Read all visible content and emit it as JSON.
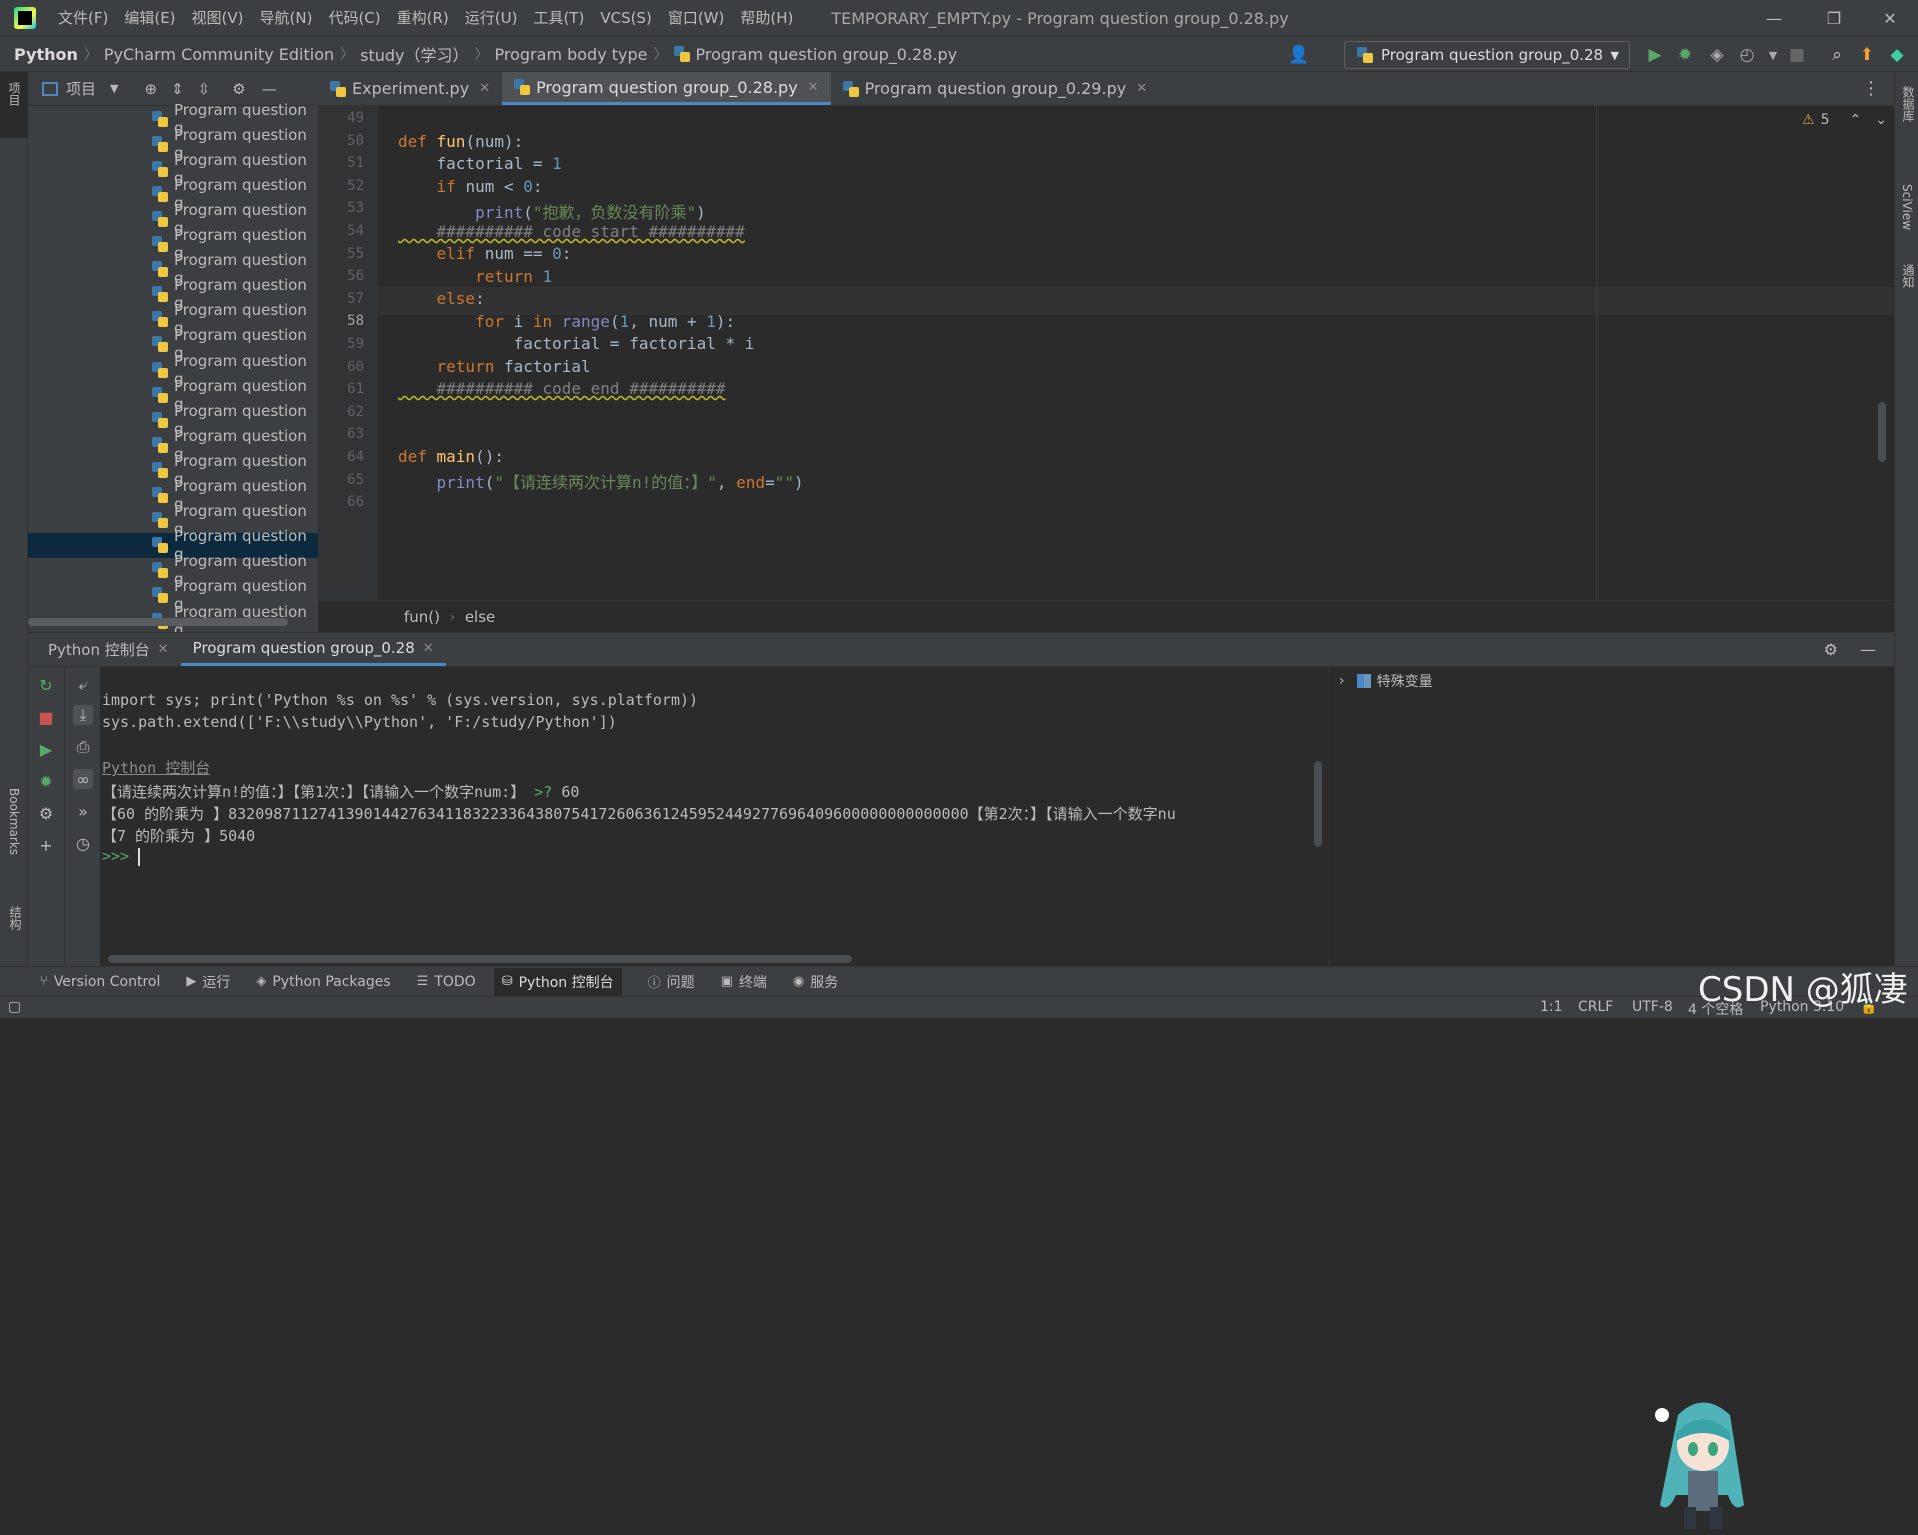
{
  "menu": [
    "文件(F)",
    "编辑(E)",
    "视图(V)",
    "导航(N)",
    "代码(C)",
    "重构(R)",
    "运行(U)",
    "工具(T)",
    "VCS(S)",
    "窗口(W)",
    "帮助(H)"
  ],
  "window_title": "TEMPORARY_EMPTY.py - Program question group_0.28.py",
  "breadcrumbs": [
    "Python",
    "PyCharm Community Edition",
    "study（学习）",
    "Program body type",
    "Program question group_0.28.py"
  ],
  "run_config": "Program question group_0.28",
  "project_panel": {
    "title": "项目",
    "item_label": "Program question g",
    "selected_index": 17,
    "count": 21
  },
  "editor_tabs": [
    {
      "label": "Experiment.py"
    },
    {
      "label": "Program question group_0.28.py"
    },
    {
      "label": "Program question group_0.29.py"
    }
  ],
  "warnings": "5",
  "line_numbers": [
    "49",
    "50",
    "51",
    "52",
    "53",
    "54",
    "55",
    "56",
    "57",
    "58",
    "59",
    "60",
    "61",
    "62",
    "63",
    "64",
    "65",
    "66"
  ],
  "code": {
    "l51_def": "def ",
    "l51_fn": "fun",
    "l51_rest": "(num):",
    "l52_a": "    factorial = ",
    "l52_n": "1",
    "l53_kw": "    if ",
    "l53_rest": "num < ",
    "l53_n": "0",
    "l53_c": ":",
    "l54_bi": "        print",
    "l54_p": "(",
    "l54_s": "\"抱歉，负数没有阶乘\"",
    "l54_e": ")",
    "l55_cm": "    ########## code start ##########",
    "l56_kw": "    elif ",
    "l56_rest": "num == ",
    "l56_n": "0",
    "l56_c": ":",
    "l57_kw": "        return ",
    "l57_n": "1",
    "l58_kw": "    else",
    ":": ":",
    "l59_kw": "        for ",
    "l59_a": "i ",
    "l59_in": "in ",
    "l59_bi": "range",
    "l59_p": "(",
    "l59_n1": "1",
    "l59_b": ", num + ",
    "l59_n2": "1",
    "l59_e": "):",
    "l60": "            factorial = factorial * i",
    "l61_kw": "    return ",
    "l61_rest": "factorial",
    "l62_cm": "    ########## code end ##########",
    "l65_def": "def ",
    "l65_fn": "main",
    "l65_rest": "():",
    "l66_bi": "    print",
    "l66_p": "(",
    "l66_s": "\"【请连续两次计算n!的值：】\"",
    "l66_c": ", ",
    "l66_kw": "end",
    "l66_eq": "=",
    "l66_s2": "\"\"",
    "l66_e": ")"
  },
  "editor_breadcrumb": [
    "fun()",
    "else"
  ],
  "bottom_tabs": [
    "Python 控制台",
    "Program question group_0.28"
  ],
  "console": {
    "line1": "import sys; print('Python %s on %s' % (sys.version, sys.platform))",
    "line2": "sys.path.extend(['F:\\\\study\\\\Python', 'F:/study/Python'])",
    "line3": "Python 控制台",
    "line4a": "【请连续两次计算n!的值：】【第1次：】【请输入一个数字num:】 ",
    "line4p": ">? ",
    "line4v": "60",
    "line5": "【60 的阶乘为 】8320987112741390144276341183223364380754172606361245952449277696409600000000000000【第2次：】【请输入一个数字nu",
    "line6": "【7 的阶乘为 】5040",
    "prompt": ">>> "
  },
  "vars_panel": "特殊变量",
  "tool_windows": [
    "Version Control",
    "运行",
    "Python Packages",
    "TODO",
    "Python 控制台",
    "问题",
    "终端",
    "服务"
  ],
  "status": {
    "pos": "1:1",
    "eol": "CRLF",
    "enc": "UTF-8",
    "indent": "4 个空格",
    "interp": "Python 3.10"
  },
  "side_labels": {
    "project": "项目",
    "bookmarks": "Bookmarks",
    "structure": "结构",
    "database": "数据库",
    "sciview": "SciView",
    "notifications": "通知"
  },
  "watermark": "CSDN @狐凄"
}
